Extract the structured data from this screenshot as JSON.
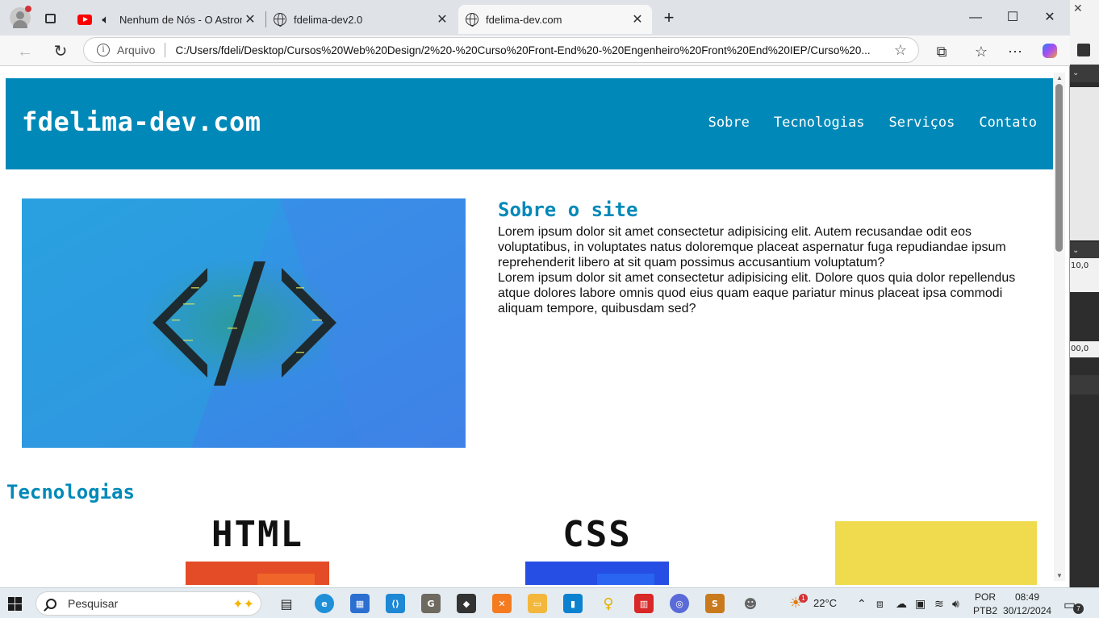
{
  "browser": {
    "tabs": [
      {
        "title": "Nenhum de Nós - O Astronauta",
        "icon": "youtube-icon",
        "active": false
      },
      {
        "title": "fdelima-dev2.0",
        "icon": "globe-icon",
        "active": false
      },
      {
        "title": "fdelima-dev.com",
        "icon": "globe-icon",
        "active": true
      }
    ],
    "new_tab_label": "+",
    "window_controls": {
      "minimize": "—",
      "maximize": "☐",
      "close": "✕"
    },
    "address": {
      "scheme_label": "Arquivo",
      "url": "C:/Users/fdeli/Desktop/Cursos%20Web%20Design/2%20-%20Curso%20Front-End%20-%20Engenheiro%20Front%20End%20IEP/Curso%20..."
    }
  },
  "site": {
    "logo": "fdelima-dev.com",
    "nav": [
      "Sobre",
      "Tecnologias",
      "Serviços",
      "Contato"
    ],
    "about": {
      "title": "Sobre o site",
      "paragraphs": [
        "Lorem ipsum dolor sit amet consectetur adipisicing elit. Autem recusandae odit eos voluptatibus, in voluptates natus doloremque placeat aspernatur fuga repudiandae ipsum reprehenderit libero at sit quam possimus accusantium voluptatum?",
        "Lorem ipsum dolor sit amet consectetur adipisicing elit. Dolore quos quia dolor repellendus atque dolores labore omnis quod eius quam eaque pariatur minus placeat ipsa commodi aliquam tempore, quibusdam sed?"
      ]
    },
    "tech": {
      "title": "Tecnologias",
      "items": [
        {
          "label": "HTML",
          "color": "#e34c26",
          "accent": "#f06529"
        },
        {
          "label": "CSS",
          "color": "#264de4",
          "accent": "#2965f1"
        },
        {
          "label": "",
          "color": "#f0db4f",
          "accent": "#f0db4f"
        }
      ]
    }
  },
  "taskbar": {
    "search_placeholder": "Pesquisar",
    "weather": "22°C",
    "weather_badge": "1",
    "lang": "POR",
    "layout": "PTB2",
    "time": "08:49",
    "date": "30/12/2024",
    "notif_count": "7"
  },
  "side_app": {
    "value1": "10,0",
    "value2": "00,0"
  },
  "colors": {
    "header": "#0089b8",
    "accent_text": "#0089b8"
  }
}
